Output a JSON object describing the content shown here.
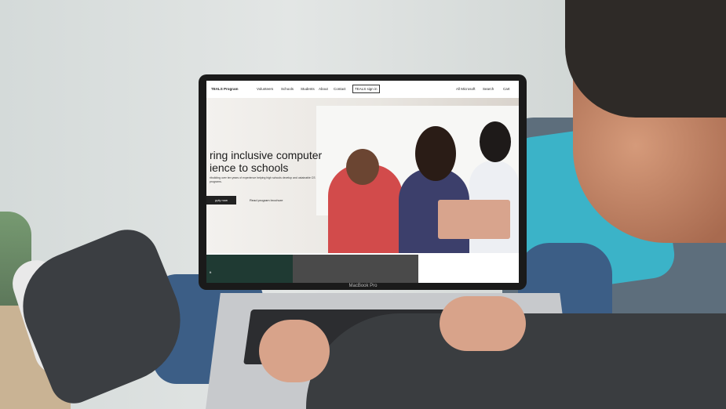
{
  "site": {
    "nav": {
      "brand": "TEALS Program",
      "items": [
        "Volunteers",
        "Schools",
        "Students",
        "About",
        "Contact"
      ],
      "signin": "TEALS sign in",
      "right": [
        "All Microsoft",
        "Search",
        "Cart"
      ]
    },
    "hero": {
      "title": "ring inclusive computer ience to schools",
      "subtitle": "ribuilding over ten years of experience helping high schools develop and ustainable CS programs.",
      "apply_button": "pply now",
      "read_link": "Read program brochure"
    },
    "tiles": {
      "tile1_text": "ft"
    }
  },
  "device": {
    "brand": "MacBook Pro"
  }
}
